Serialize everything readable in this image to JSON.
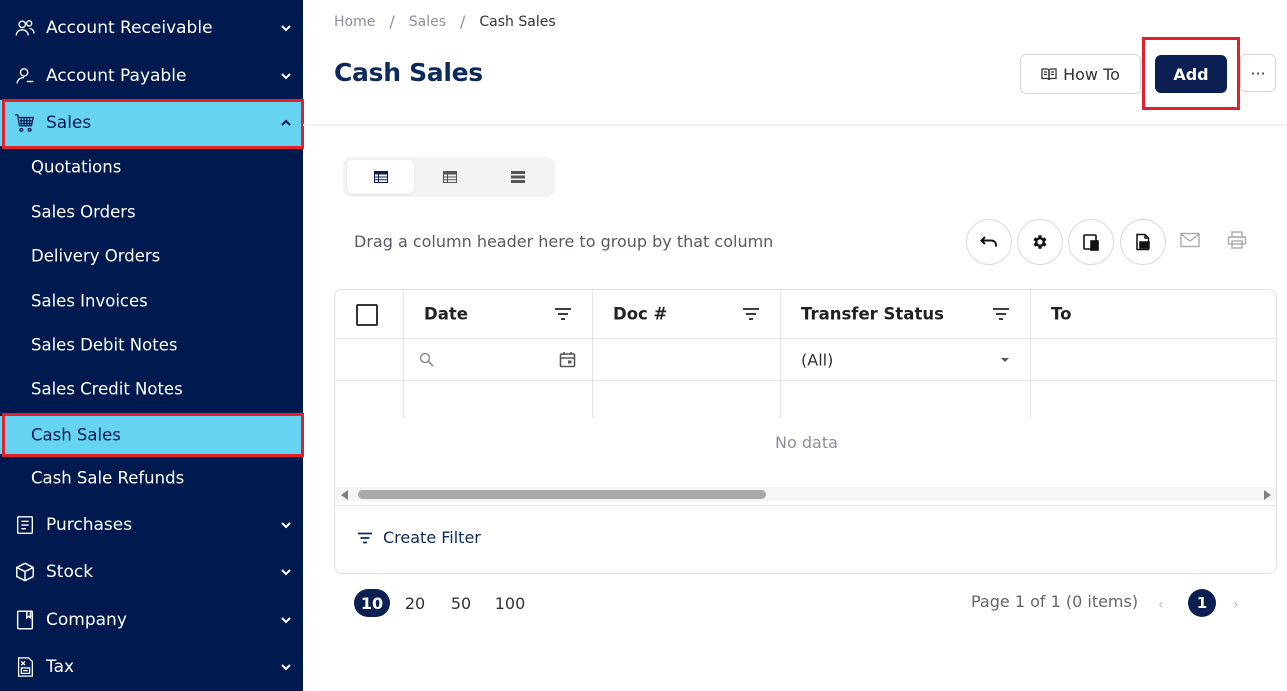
{
  "sidebar": {
    "items": [
      {
        "label": "Account Receivable",
        "icon": "users-icon"
      },
      {
        "label": "Account Payable",
        "icon": "user-icon"
      },
      {
        "label": "Sales",
        "icon": "cart-icon"
      },
      {
        "label": "Purchases",
        "icon": "receipt-icon"
      },
      {
        "label": "Stock",
        "icon": "box-icon"
      },
      {
        "label": "Company",
        "icon": "building-icon"
      },
      {
        "label": "Tax",
        "icon": "tax-icon"
      }
    ],
    "sales_sub": [
      {
        "label": "Quotations"
      },
      {
        "label": "Sales Orders"
      },
      {
        "label": "Delivery Orders"
      },
      {
        "label": "Sales Invoices"
      },
      {
        "label": "Sales Debit Notes"
      },
      {
        "label": "Sales Credit Notes"
      },
      {
        "label": "Cash Sales"
      },
      {
        "label": "Cash Sale Refunds"
      }
    ],
    "active_item": "Sales",
    "active_sub": "Cash Sales"
  },
  "breadcrumb": {
    "home": "Home",
    "section": "Sales",
    "current": "Cash Sales"
  },
  "page": {
    "title": "Cash Sales"
  },
  "actions": {
    "howto_label": "How To",
    "add_label": "Add",
    "more_label": "···"
  },
  "grid": {
    "group_hint": "Drag a column header here to group by that column",
    "columns": [
      {
        "label": "Date"
      },
      {
        "label": "Doc #"
      },
      {
        "label": "Transfer Status"
      },
      {
        "label": "To"
      }
    ],
    "transfer_status_filter": "(All)",
    "empty_text": "No data",
    "create_filter_label": "Create Filter"
  },
  "pager": {
    "sizes": [
      "10",
      "20",
      "50",
      "100"
    ],
    "selected_size": "10",
    "info": "Page 1 of 1 (0 items)",
    "current_page": "1",
    "prev": "‹",
    "next": "›"
  },
  "colors": {
    "sidebar_bg": "#001a4f",
    "active_bg": "#66d3f2",
    "primary": "#0b1f52",
    "highlight": "#e0202a"
  }
}
